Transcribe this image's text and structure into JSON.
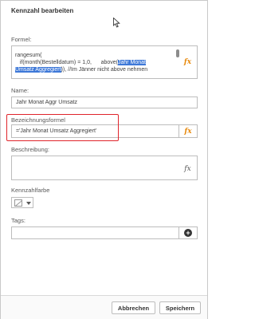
{
  "dialog": {
    "title": "Kennzahl bearbeiten"
  },
  "formula": {
    "label": "Formel:",
    "line1": "rangesum(",
    "line2_pre": "   if(month(Bestelldatum) = 1,0,      above(",
    "line2_hl": "Jahr Monat",
    "line3_hl": "Umsatz Aggregiert",
    "line3_post": ")), //Im Jänner nicht above nehmen"
  },
  "name": {
    "label": "Name:",
    "value": "Jahr Monat Aggr Umsatz"
  },
  "label_expression": {
    "label": "Bezeichnungsformel",
    "value": "='Jahr Monat Umsatz Aggregiert'"
  },
  "description": {
    "label": "Beschreibung:"
  },
  "color": {
    "label": "Kennzahlfarbe"
  },
  "tags": {
    "label": "Tags:",
    "value": ""
  },
  "footer": {
    "cancel_label": "Abbrechen",
    "save_label": "Speichern"
  },
  "icons": {
    "fx": "fx",
    "add": "+"
  },
  "colors": {
    "fx_accent": "#e8890c",
    "selection": "#3d78d8",
    "callout": "#e0242b"
  }
}
